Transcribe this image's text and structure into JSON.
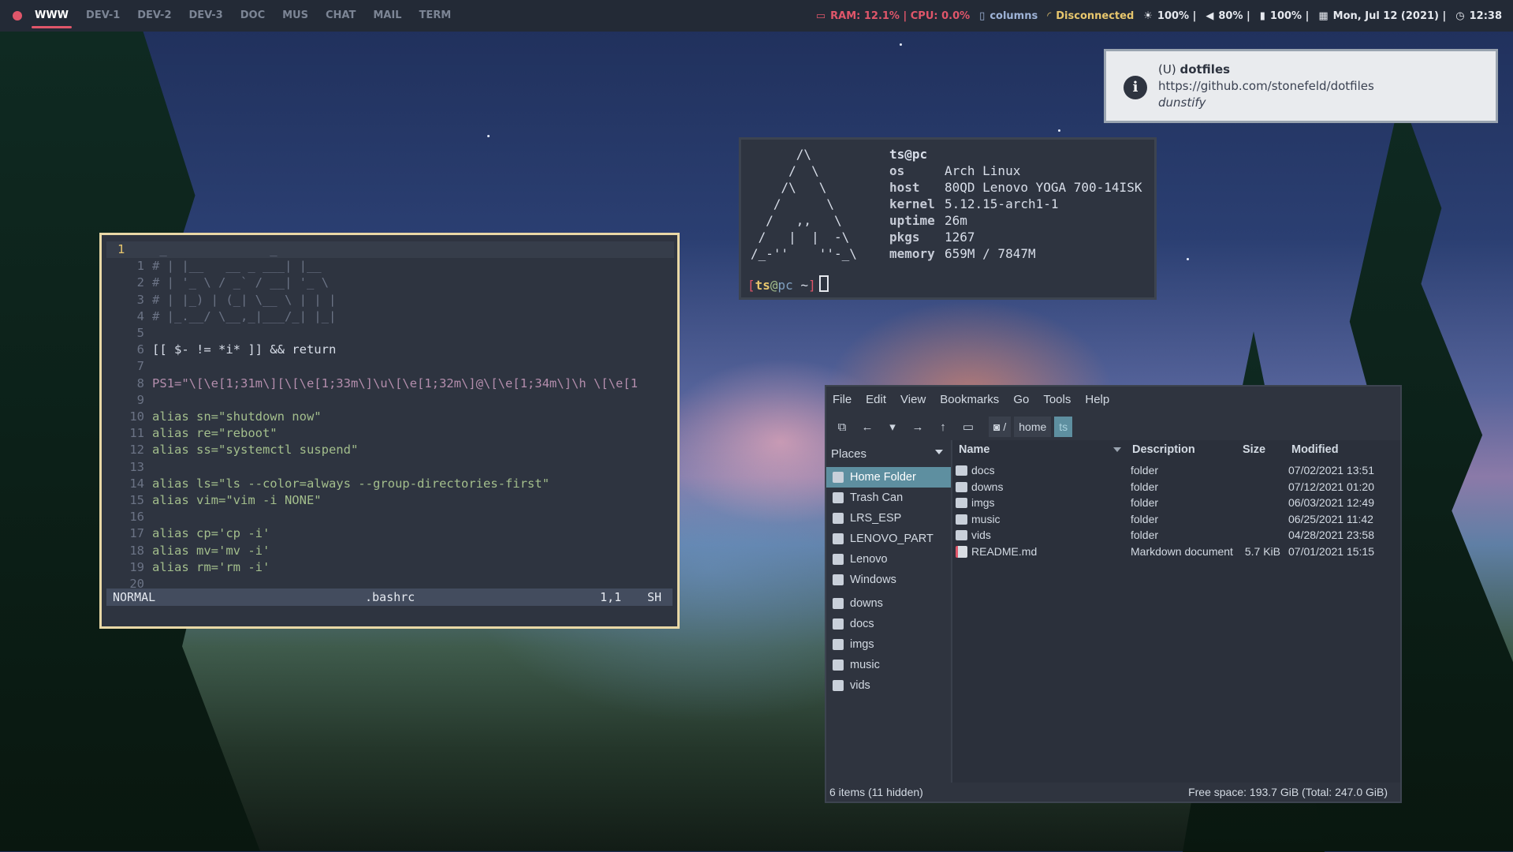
{
  "topbar": {
    "workspaces": [
      "WWW",
      "DEV-1",
      "DEV-2",
      "DEV-3",
      "DOC",
      "MUS",
      "CHAT",
      "MAIL",
      "TERM"
    ],
    "active_workspace": "WWW",
    "ram_cpu": "RAM: 12.1% | CPU: 0.0%",
    "layout": "columns",
    "network": "Disconnected",
    "brightness": "100% |",
    "volume": "80% |",
    "battery": "100% |",
    "date": "Mon, Jul 12 (2021) |",
    "time": "12:38"
  },
  "notification": {
    "prefix": "(U)",
    "title": "dotfiles",
    "body": "https://github.com/stonefeld/dotfiles",
    "app": "dunstify"
  },
  "neofetch": {
    "ascii": "      /\\\n     /  \\\n    /\\   \\\n   /      \\\n  /   ,,   \\\n /   |  |  -\\\n/_-''    ''-_\\",
    "user": "ts@pc",
    "rows": [
      {
        "k": "os",
        "v": "Arch Linux"
      },
      {
        "k": "host",
        "v": "80QD Lenovo YOGA 700-14ISK"
      },
      {
        "k": "kernel",
        "v": "5.12.15-arch1-1"
      },
      {
        "k": "uptime",
        "v": "26m"
      },
      {
        "k": "pkgs",
        "v": "1267"
      },
      {
        "k": "memory",
        "v": "659M / 7847M"
      }
    ],
    "prompt": {
      "open": "[",
      "user": "ts",
      "at": "@",
      "host": "pc",
      "path": "~",
      "close": "]"
    }
  },
  "vim": {
    "lines": [
      {
        "n": "1",
        "t": " _              _"
      },
      {
        "n": "1",
        "t": "# | |__   __ _ ___| |__"
      },
      {
        "n": "2",
        "t": "# | '_ \\ / _` / __| '_ \\"
      },
      {
        "n": "3",
        "t": "# | |_) | (_| \\__ \\ | | |"
      },
      {
        "n": "4",
        "t": "# |_.__/ \\__,_|___/_| |_|"
      },
      {
        "n": "5",
        "t": ""
      },
      {
        "n": "6",
        "t": "[[ $- != *i* ]] && return"
      },
      {
        "n": "7",
        "t": ""
      },
      {
        "n": "8",
        "t": "PS1=\"\\[\\e[1;31m\\][\\[\\e[1;33m\\]\\u\\[\\e[1;32m\\]@\\[\\e[1;34m\\]\\h \\[\\e[1"
      },
      {
        "n": "9",
        "t": ""
      },
      {
        "n": "10",
        "t": "alias sn=\"shutdown now\""
      },
      {
        "n": "11",
        "t": "alias re=\"reboot\""
      },
      {
        "n": "12",
        "t": "alias ss=\"systemctl suspend\""
      },
      {
        "n": "13",
        "t": ""
      },
      {
        "n": "14",
        "t": "alias ls=\"ls --color=always --group-directories-first\""
      },
      {
        "n": "15",
        "t": "alias vim=\"vim -i NONE\""
      },
      {
        "n": "16",
        "t": ""
      },
      {
        "n": "17",
        "t": "alias cp='cp -i'"
      },
      {
        "n": "18",
        "t": "alias mv='mv -i'"
      },
      {
        "n": "19",
        "t": "alias rm='rm -i'"
      },
      {
        "n": "20",
        "t": ""
      }
    ],
    "status": {
      "mode": "NORMAL",
      "file": ".bashrc",
      "pos": "1,1",
      "ft": "SH"
    }
  },
  "filemanager": {
    "menu": [
      "File",
      "Edit",
      "View",
      "Bookmarks",
      "Go",
      "Tools",
      "Help"
    ],
    "breadcrumb": {
      "root": "/",
      "home": "home",
      "current": "ts"
    },
    "places_label": "Places",
    "places": [
      "Home Folder",
      "Trash Can",
      "LRS_ESP",
      "LENOVO_PART",
      "Lenovo",
      "Windows"
    ],
    "bookmarks": [
      "downs",
      "docs",
      "imgs",
      "music",
      "vids"
    ],
    "columns": {
      "name": "Name",
      "description": "Description",
      "size": "Size",
      "modified": "Modified"
    },
    "files": [
      {
        "name": "docs",
        "description": "folder",
        "size": "",
        "modified": "07/02/2021 13:51",
        "kind": "folder"
      },
      {
        "name": "downs",
        "description": "folder",
        "size": "",
        "modified": "07/12/2021 01:20",
        "kind": "folder"
      },
      {
        "name": "imgs",
        "description": "folder",
        "size": "",
        "modified": "06/03/2021 12:49",
        "kind": "folder"
      },
      {
        "name": "music",
        "description": "folder",
        "size": "",
        "modified": "06/25/2021 11:42",
        "kind": "folder"
      },
      {
        "name": "vids",
        "description": "folder",
        "size": "",
        "modified": "04/28/2021 23:58",
        "kind": "folder"
      },
      {
        "name": "README.md",
        "description": "Markdown document",
        "size": "5.7 KiB",
        "modified": "07/01/2021 15:15",
        "kind": "doc"
      }
    ],
    "status_left": "6 items (11 hidden)",
    "status_right": "Free space: 193.7 GiB (Total: 247.0 GiB)"
  },
  "colors": {
    "accent": "#e0566a",
    "selection": "#5e8fa0",
    "bar_bg": "#232a36",
    "term_bg": "#2e3440"
  }
}
